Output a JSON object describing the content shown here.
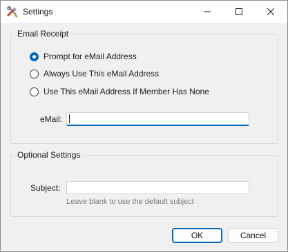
{
  "window": {
    "title": "Settings",
    "app_icon": "tools-icon",
    "controls": [
      "minimize-icon",
      "maximize-icon",
      "close-icon"
    ]
  },
  "email_receipt": {
    "group_label": "Email Receipt",
    "options": [
      {
        "label": "Prompt for eMail Address",
        "checked": true
      },
      {
        "label": "Always Use This eMail Address",
        "checked": false
      },
      {
        "label": "Use This eMail Address If Member Has None",
        "checked": false
      }
    ],
    "email_label": "eMail:",
    "email_value": ""
  },
  "optional_settings": {
    "group_label": "Optional Settings",
    "subject_label": "Subject:",
    "subject_value": "",
    "subject_hint": "Leave blank to use the default subject"
  },
  "buttons": {
    "ok": "OK",
    "cancel": "Cancel"
  },
  "colors": {
    "accent": "#0067c0",
    "background": "#f0f0f0"
  }
}
